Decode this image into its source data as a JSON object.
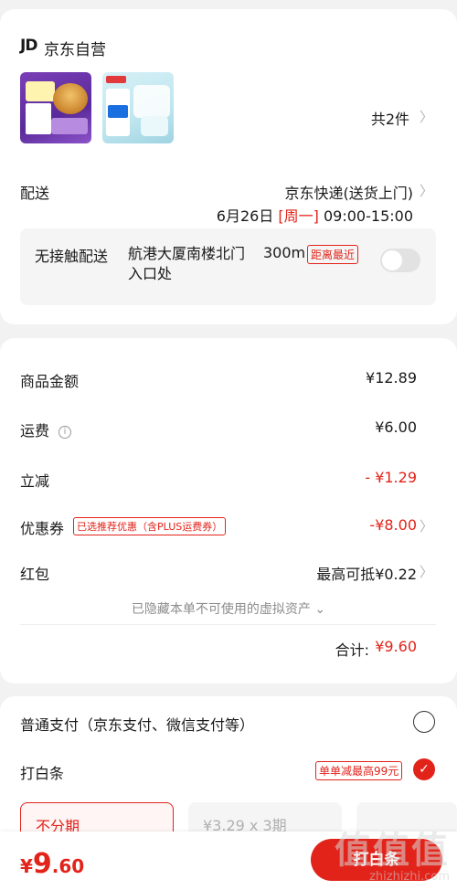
{
  "store": {
    "logo_text": "JD",
    "name": "京东自营"
  },
  "items": {
    "count_label": "共2件"
  },
  "shipping": {
    "label": "配送",
    "method": "京东快递(送货上门)",
    "date": "6月26日",
    "weekday": "[周一]",
    "time": "09:00-15:00",
    "contactless": {
      "label": "无接触配送",
      "address": "航港大厦南楼北门入口处",
      "distance": "300m",
      "tag": "距离最近",
      "enabled": false
    }
  },
  "summary": {
    "goods_label": "商品金额",
    "goods_value": "¥12.89",
    "freight_label": "运费",
    "freight_value": "¥6.00",
    "discount_label": "立减",
    "discount_value": "- ¥1.29",
    "coupon_label": "优惠券",
    "coupon_tag": "已选推荐优惠（含PLUS运费券）",
    "coupon_value": "-¥8.00",
    "redpack_label": "红包",
    "redpack_value": "最高可抵¥0.22",
    "hidden_note": "已隐藏本单不可使用的虚拟资产",
    "total_label": "合计:",
    "total_value": "¥9.60"
  },
  "payment": {
    "normal_label": "普通支付（京东支付、微信支付等）",
    "baitiao_label": "打白条",
    "baitiao_promo": "单单减最高99元",
    "options": [
      "不分期",
      "¥3.29 x 3期",
      ""
    ]
  },
  "bottom": {
    "currency": "¥",
    "amount_int": "9",
    "amount_dec": ".60",
    "pay_button": "打白条"
  },
  "watermark": {
    "logo": "值值值",
    "url": "zhizhizhi.com"
  }
}
